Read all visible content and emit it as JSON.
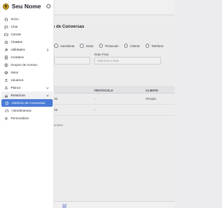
{
  "brand": {
    "name": "Seu Nome"
  },
  "sidebar": {
    "items": [
      {
        "label": "Início",
        "icon": "home-icon"
      },
      {
        "label": "Chat",
        "icon": "chat-bubble-icon"
      },
      {
        "label": "Canais",
        "icon": "folder-icon"
      },
      {
        "label": "ChatBot",
        "icon": "robot-icon"
      },
      {
        "label": "Utilidades",
        "icon": "tools-icon"
      },
      {
        "label": "Contatos",
        "icon": "contact-book-icon"
      },
      {
        "label": "Grupos de Acesso",
        "icon": "users-group-icon"
      },
      {
        "label": "Setor",
        "icon": "layers-icon"
      },
      {
        "label": "Usuários",
        "icon": "users-icon"
      },
      {
        "label": "Planos",
        "icon": "rocket-icon"
      },
      {
        "label": "Relatórios",
        "icon": "bar-chart-icon"
      },
      {
        "label": "Histórico de Conversas",
        "icon": "history-icon"
      },
      {
        "label": "Atendimentos",
        "icon": "headset-icon"
      },
      {
        "label": "Personalizar",
        "icon": "gear-icon"
      }
    ]
  },
  "background": {
    "title": "órico de Conversas",
    "radios": [
      "Atendente",
      "Setor",
      "Protocolo",
      "Cliente",
      "Telefone"
    ],
    "date_label": "Data Final",
    "date_placeholder": "Selecione a data",
    "table": {
      "headers": [
        "",
        "PROTOCOLO",
        "CLIENTE"
      ],
      "rows": [
        [
          "05",
          "-",
          "Privado"
        ],
        [
          "05",
          "-",
          ""
        ]
      ]
    },
    "footer": "entries",
    "bottom_link": "ital"
  }
}
